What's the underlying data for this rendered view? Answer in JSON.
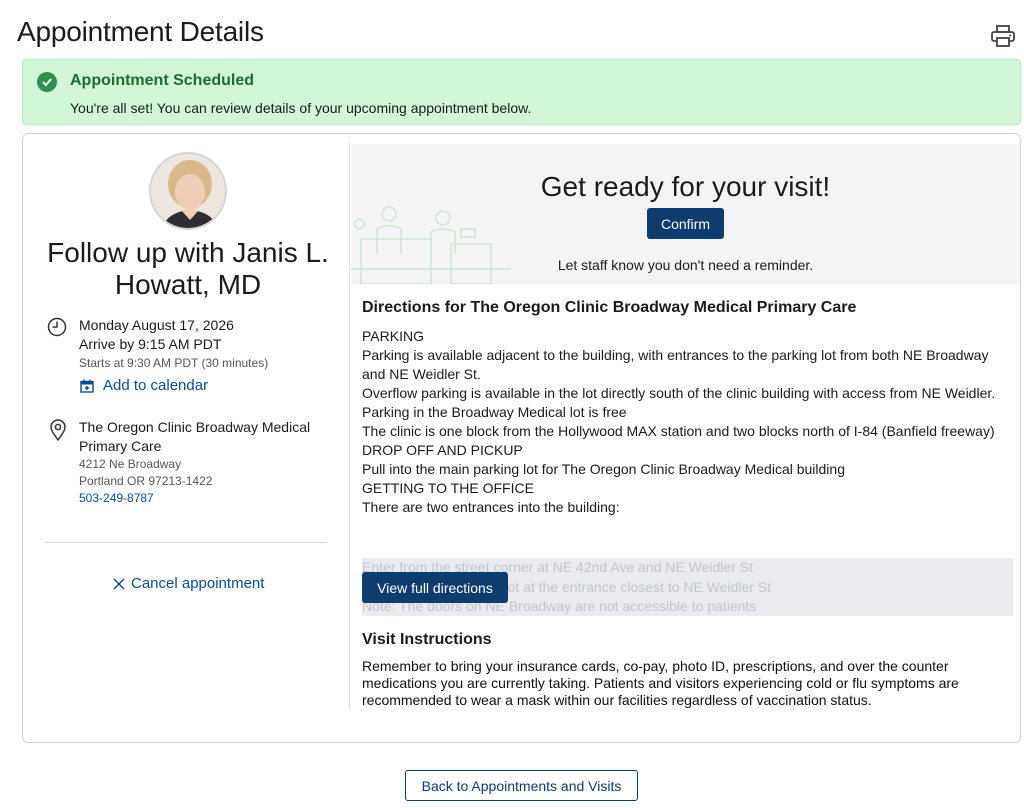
{
  "page": {
    "title": "Appointment Details"
  },
  "alert": {
    "title": "Appointment Scheduled",
    "message": "You're all set! You can review details of your upcoming appointment below."
  },
  "appointment": {
    "title": "Follow up with Janis L. Howatt, MD",
    "date": "Monday August 17, 2026",
    "arrive": "Arrive by 9:15 AM PDT",
    "starts": "Starts at 9:30 AM PDT (30 minutes)",
    "add_to_calendar": "Add to calendar",
    "location": {
      "name": "The Oregon Clinic Broadway Medical Primary Care",
      "street": "4212 Ne Broadway",
      "city": "Portland OR 97213-1422",
      "phone": "503-249-8787"
    },
    "cancel": "Cancel appointment"
  },
  "ready": {
    "title": "Get ready for your visit!",
    "confirm": "Confirm",
    "subtitle": "Let staff know you don't need a reminder."
  },
  "directions": {
    "title": "Directions for The Oregon Clinic Broadway Medical Primary Care",
    "lines": [
      "PARKING",
      "Parking is available adjacent to the building, with entrances to the parking lot from both NE Broadway and NE Weidler St.",
      "Overflow parking is available in the lot directly south of the clinic building with access from NE Weidler.",
      "Parking in the Broadway Medical lot is free",
      "The clinic is one block from the Hollywood MAX station and two blocks north of I-84 (Banfield freeway)",
      "DROP OFF AND PICKUP",
      "Pull into the main parking lot for The Oregon Clinic Broadway Medical building",
      "GETTING TO THE OFFICE",
      "There are two entrances into the building:"
    ],
    "faded_lines": [
      "Enter from the street corner at NE 42nd Ave and NE Weidler St",
      "Enter from the parking lot at the entrance closest to NE Weidler St",
      "Note: The doors on NE Broadway are not accessible to patients"
    ],
    "view_full": "View full directions"
  },
  "visit_instructions": {
    "title": "Visit Instructions",
    "body": "Remember to bring your insurance cards, co-pay, photo ID, prescriptions, and over the counter medications you are currently taking. Patients and visitors experiencing cold or flu symptoms are recommended to wear a mask within our facilities regardless of vaccination status."
  },
  "back_button": "Back to Appointments and Visits",
  "icons": {
    "print": "printer-icon",
    "check": "check-circle-icon",
    "clock": "clock-icon",
    "calendar": "calendar-icon",
    "pin": "map-pin-icon",
    "close": "close-icon"
  },
  "colors": {
    "success_bg": "#d1f6d8",
    "success_text": "#1e6b35",
    "primary": "#0e3c6e",
    "link": "#0b4b8c"
  }
}
